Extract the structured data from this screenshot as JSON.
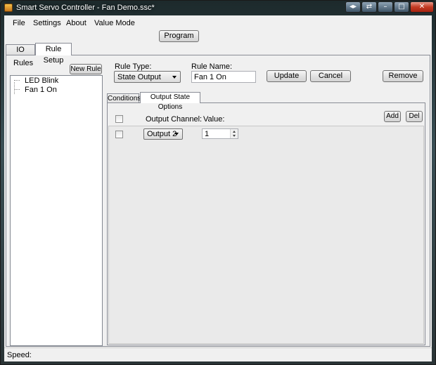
{
  "window": {
    "title": "Smart Servo Controller - Fan Demo.ssc*",
    "controls": {
      "extra1": "◂▸",
      "extra2": "⇄",
      "minimize": "–",
      "maximize": "□",
      "close": "✕"
    }
  },
  "menu": {
    "file": "File",
    "settings": "Settings",
    "about": "About",
    "value_mode": "Value Mode"
  },
  "toolbar": {
    "program": "Program"
  },
  "main_tabs": {
    "io_setup": "IO Setup",
    "rule_setup": "Rule Setup"
  },
  "rules_panel": {
    "title": "Rules",
    "new_rule": "New Rule",
    "items": [
      "LED Blink",
      "Fan 1 On"
    ]
  },
  "rule_editor": {
    "rule_type_label": "Rule Type:",
    "rule_type_value": "State Output",
    "rule_name_label": "Rule Name:",
    "rule_name_value": "Fan 1 On",
    "update": "Update",
    "cancel": "Cancel",
    "remove": "Remove"
  },
  "sub_tabs": {
    "conditions": "Conditions",
    "output_state_options": "Output State Options"
  },
  "output_options": {
    "output_channel_header": "Output Channel:",
    "value_header": "Value:",
    "add": "Add",
    "del": "Del",
    "rows": [
      {
        "channel": "Output 2",
        "value": "1"
      }
    ]
  },
  "status": {
    "speed_label": "Speed:"
  }
}
